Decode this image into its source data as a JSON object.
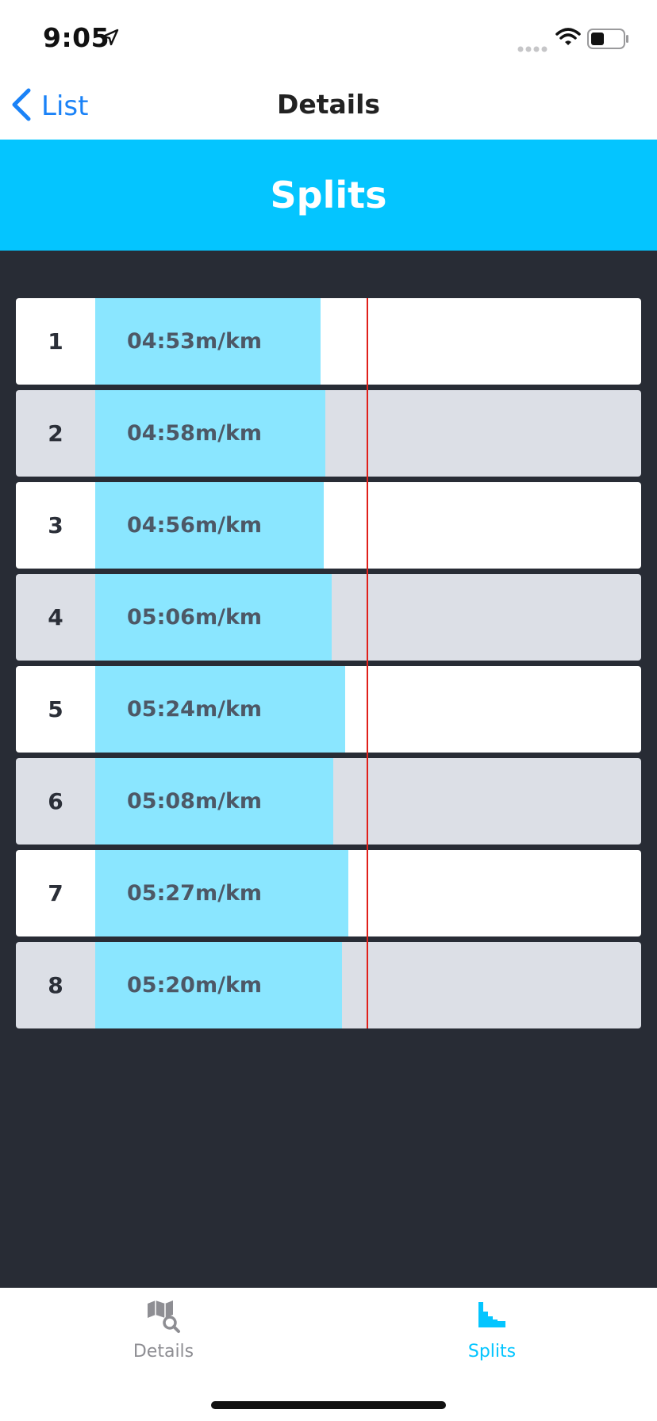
{
  "status_bar": {
    "time": "9:05"
  },
  "nav": {
    "back_label": "List",
    "title": "Details"
  },
  "header": {
    "title": "Splits"
  },
  "splits": [
    {
      "index": "1",
      "pace": "04:53m/km",
      "fraction": 0.413
    },
    {
      "index": "2",
      "pace": "04:58m/km",
      "fraction": 0.421
    },
    {
      "index": "3",
      "pace": "04:56m/km",
      "fraction": 0.418
    },
    {
      "index": "4",
      "pace": "05:06m/km",
      "fraction": 0.433
    },
    {
      "index": "5",
      "pace": "05:24m/km",
      "fraction": 0.458
    },
    {
      "index": "6",
      "pace": "05:08m/km",
      "fraction": 0.436
    },
    {
      "index": "7",
      "pace": "05:27m/km",
      "fraction": 0.463
    },
    {
      "index": "8",
      "pace": "05:20m/km",
      "fraction": 0.452
    }
  ],
  "tabs": [
    {
      "label": "Details",
      "icon": "map-search-icon",
      "active": false
    },
    {
      "label": "Splits",
      "icon": "splits-chart-icon",
      "active": true
    }
  ],
  "colors": {
    "accent": "#04c5ff",
    "bar_fill": "#8ae6ff",
    "average_line": "#e0201a",
    "row_odd": "#ffffff",
    "row_even": "#dcdfe6",
    "background": "#282c35",
    "tab_active": "#04c5ff",
    "tab_inactive": "#8e8e93",
    "link": "#1a82f7"
  }
}
